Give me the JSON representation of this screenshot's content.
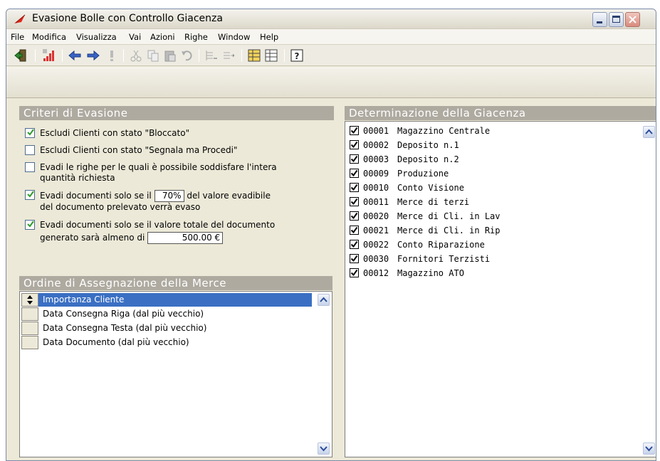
{
  "window": {
    "title": "Evasione Bolle con Controllo Giacenza"
  },
  "menu": [
    "File",
    "Modifica",
    "Visualizza",
    "Vai",
    "Azioni",
    "Righe",
    "Window",
    "Help"
  ],
  "toolbar": {
    "icons": [
      "exit-icon",
      "signal-icon",
      "back-arrow-icon",
      "forward-arrow-icon",
      "exclamation-icon",
      "cut-icon",
      "copy-icon",
      "paste-icon",
      "undo-icon",
      "insert-row-icon",
      "append-row-icon",
      "grid-color-icon",
      "grid-icon",
      "help-icon"
    ]
  },
  "criteri": {
    "header": "Criteri di Evasione",
    "opt1": {
      "checked": true,
      "label": "Escludi Clienti con stato \"Bloccato\""
    },
    "opt2": {
      "checked": false,
      "label": "Escludi Clienti con stato \"Segnala ma Procedi\""
    },
    "opt3": {
      "checked": false,
      "line1": "Evadi le righe per le quali è possibile soddisfare l'intera",
      "line2": "quantità richiesta"
    },
    "opt4": {
      "checked": true,
      "before": "Evadi documenti solo se il",
      "value": "70%",
      "after": "del valore evadibile",
      "line2": "del documento prelevato verrà evaso"
    },
    "opt5": {
      "checked": true,
      "line1": "Evadi documenti solo se il valore totale del documento",
      "before": "generato sarà almeno di",
      "value": "500.00 €"
    }
  },
  "ordine": {
    "header": "Ordine di Assegnazione della Merce",
    "items": [
      {
        "label": "Importanza Cliente",
        "selected": true
      },
      {
        "label": "Data Consegna Riga (dal più vecchio)",
        "selected": false
      },
      {
        "label": "Data Consegna Testa (dal più vecchio)",
        "selected": false
      },
      {
        "label": "Data Documento (dal più vecchio)",
        "selected": false
      }
    ]
  },
  "giacenza": {
    "header": "Determinazione della Giacenza",
    "items": [
      {
        "code": "00001",
        "name": "Magazzino Centrale",
        "checked": true
      },
      {
        "code": "00002",
        "name": "Deposito n.1",
        "checked": true
      },
      {
        "code": "00003",
        "name": "Deposito n.2",
        "checked": true
      },
      {
        "code": "00009",
        "name": "Produzione",
        "checked": true
      },
      {
        "code": "00010",
        "name": "Conto Visione",
        "checked": true
      },
      {
        "code": "00011",
        "name": "Merce di terzi",
        "checked": true
      },
      {
        "code": "00020",
        "name": "Merce di Cli. in Lav",
        "checked": true
      },
      {
        "code": "00021",
        "name": "Merce di Cli. in Rip",
        "checked": true
      },
      {
        "code": "00022",
        "name": "Conto Riparazione",
        "checked": true
      },
      {
        "code": "00030",
        "name": "Fornitori Terzisti",
        "checked": true
      },
      {
        "code": "00012",
        "name": "Magazzino ATO",
        "checked": true
      }
    ]
  },
  "colors": {
    "selection": "#3a6fc3",
    "section_header": "#aeaaa0",
    "window_bg": "#ece9d8"
  }
}
